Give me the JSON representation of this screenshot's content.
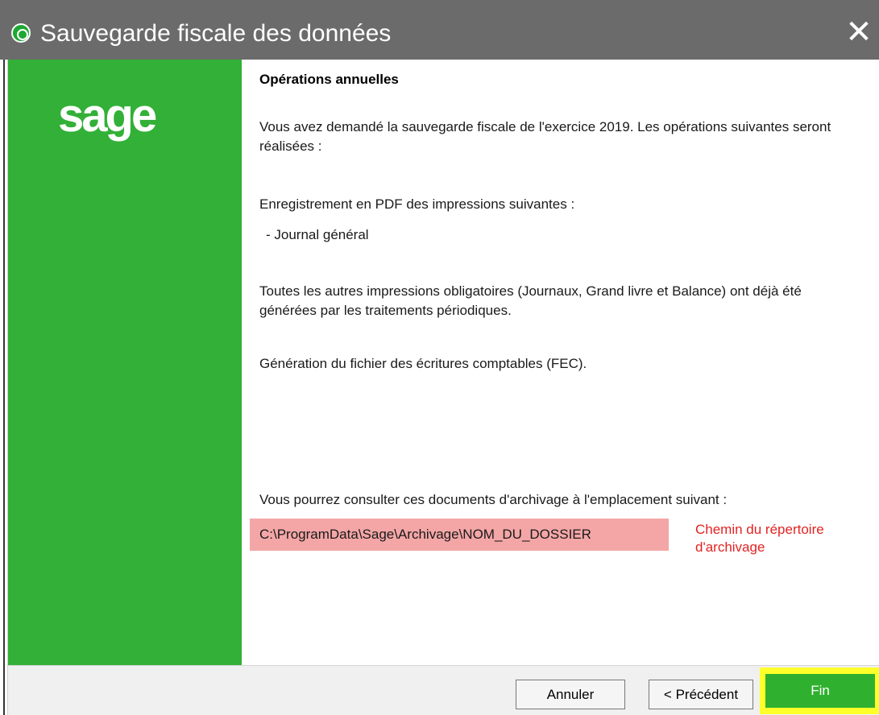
{
  "window": {
    "title": "Sauvegarde fiscale des données",
    "close_label": "✕"
  },
  "sidebar": {
    "logo_text": "sage"
  },
  "content": {
    "heading": "Opérations annuelles",
    "intro": "Vous avez demandé la sauvegarde fiscale de l'exercice 2019. Les opérations suivantes seront réalisées :",
    "pdf_intro": "Enregistrement en PDF des impressions suivantes :",
    "pdf_item": "- Journal général",
    "other_prints": "Toutes les autres impressions obligatoires (Journaux, Grand livre et Balance) ont déjà été générées par les traitements périodiques.",
    "fec": "Génération du fichier des écritures comptables (FEC).",
    "archive_intro": "Vous pourrez consulter ces documents d'archivage à l'emplacement suivant :",
    "archive_path": "C:\\ProgramData\\Sage\\Archivage\\NOM_DU_DOSSIER",
    "annotation": "Chemin du répertoire d'archivage"
  },
  "footer": {
    "cancel_label": "Annuler",
    "previous_label": "< Précédent",
    "finish_label": "Fin"
  },
  "colors": {
    "title_bar": "#6b6b6b",
    "sage_green": "#32b037",
    "path_highlight": "#f4a6a6",
    "annotation_red": "#e42222",
    "finish_highlight": "#ffff2a"
  }
}
